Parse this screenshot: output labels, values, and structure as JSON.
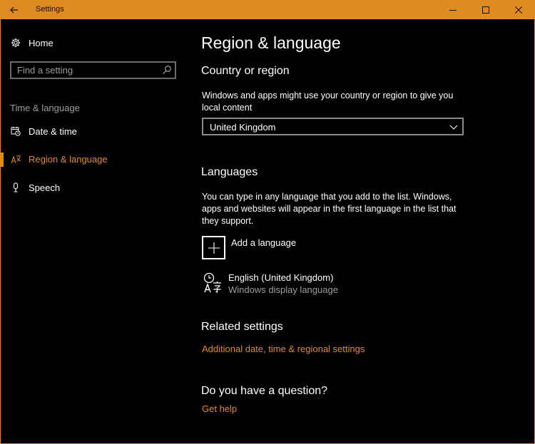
{
  "window": {
    "title": "Settings",
    "accent_color": "#e08a22"
  },
  "titlebar": {
    "back_icon": "arrow-left-icon",
    "minimize_icon": "minimize-icon",
    "maximize_icon": "maximize-icon",
    "close_icon": "close-icon"
  },
  "sidebar": {
    "home_label": "Home",
    "search_placeholder": "Find a setting",
    "section_label": "Time & language",
    "items": [
      {
        "label": "Date & time",
        "icon": "calendar-clock-icon"
      },
      {
        "label": "Region & language",
        "icon": "region-language-icon",
        "active": true
      },
      {
        "label": "Speech",
        "icon": "microphone-icon"
      }
    ]
  },
  "main": {
    "page_title": "Region & language",
    "country": {
      "heading": "Country or region",
      "description": "Windows and apps might use your country or region to give you local content",
      "selected": "United Kingdom"
    },
    "languages": {
      "heading": "Languages",
      "description": "You can type in any language that you add to the list. Windows, apps and websites will appear in the first language in the list that they support.",
      "add_label": "Add a language",
      "list": [
        {
          "name": "English (United Kingdom)",
          "detail": "Windows display language"
        }
      ]
    },
    "related": {
      "heading": "Related settings",
      "link": "Additional date, time & regional settings"
    },
    "question": {
      "heading": "Do you have a question?",
      "link": "Get help"
    }
  }
}
